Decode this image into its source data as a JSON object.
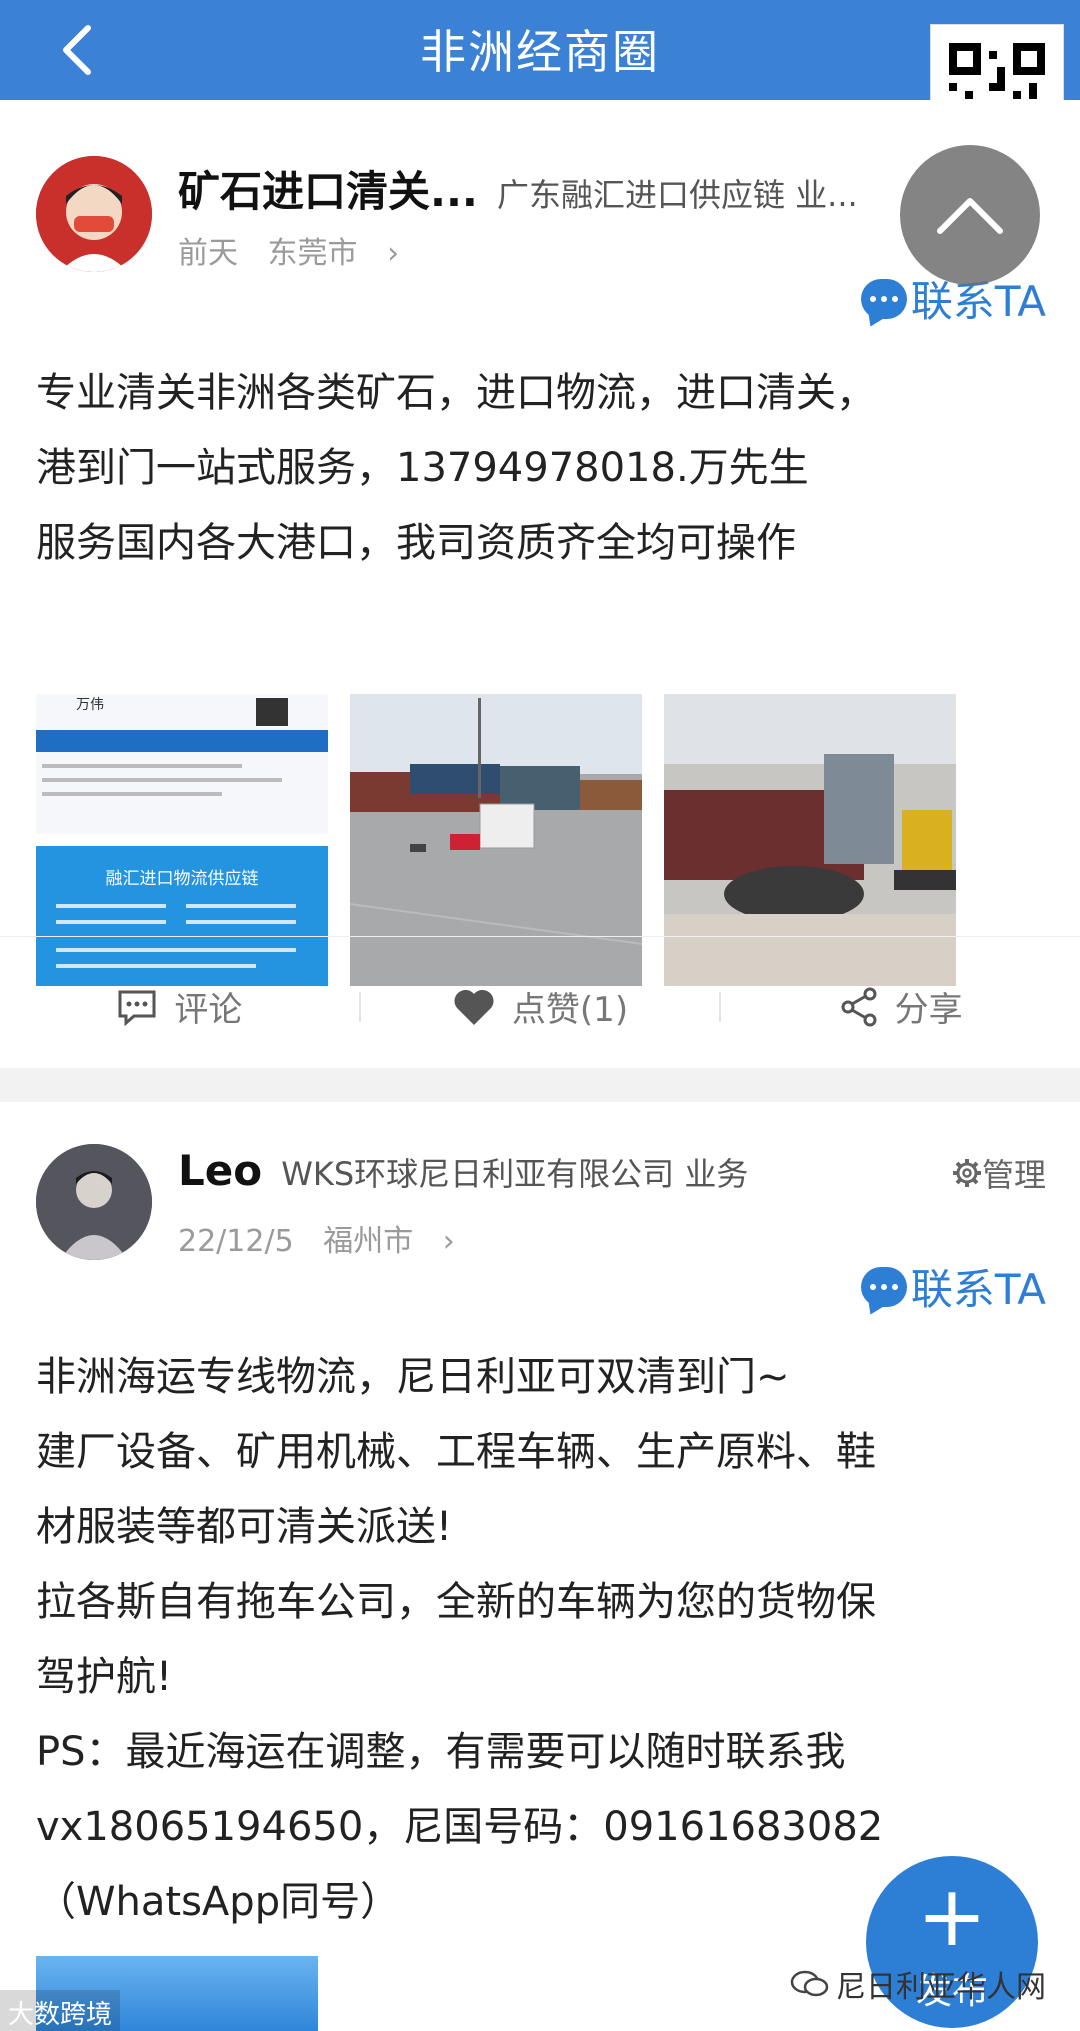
{
  "header": {
    "title": "非洲经商圈",
    "back_icon": "chevron-left-icon",
    "bg": "#3b82d6"
  },
  "scroll_top_icon": "chevron-up-icon",
  "posts": [
    {
      "name": "矿石进口清关...",
      "company": "广东融汇进口供应链 业...",
      "time": "前天",
      "city": "东莞市",
      "contact": "联系TA",
      "lines": [
        "专业清关非洲各类矿石，进口物流，进口清关，",
        "港到门一站式服务，13794978018.万先生",
        "服务国内各大港口，我司资质齐全均可操作"
      ],
      "photos": [
        {
          "title": "融汇进口物流供应链",
          "sub": "万伟"
        },
        {
          "title": ""
        },
        {
          "title": ""
        }
      ],
      "actions": {
        "comment": "评论",
        "like": "点赞(1)",
        "share": "分享"
      }
    },
    {
      "name": "Leo",
      "company": "WKS环球尼日利亚有限公司 业务",
      "manage": "管理",
      "time": "22/12/5",
      "city": "福州市",
      "contact": "联系TA",
      "lines": [
        "非洲海运专线物流，尼日利亚可双清到门~",
        "建厂设备、矿用机械、工程车辆、生产原料、鞋",
        "材服装等都可清关派送!",
        "拉各斯自有拖车公司，全新的车辆为您的货物保",
        "驾护航!",
        "PS：最近海运在调整，有需要可以随时联系我",
        "vx18065194650，尼国号码：09161683082",
        "（WhatsApp同号）"
      ]
    }
  ],
  "fab": {
    "label": "发布"
  },
  "watermark_left": "大数跨境",
  "watermark_right": "尼日利亚华人网",
  "accent": "#2d7fd6"
}
